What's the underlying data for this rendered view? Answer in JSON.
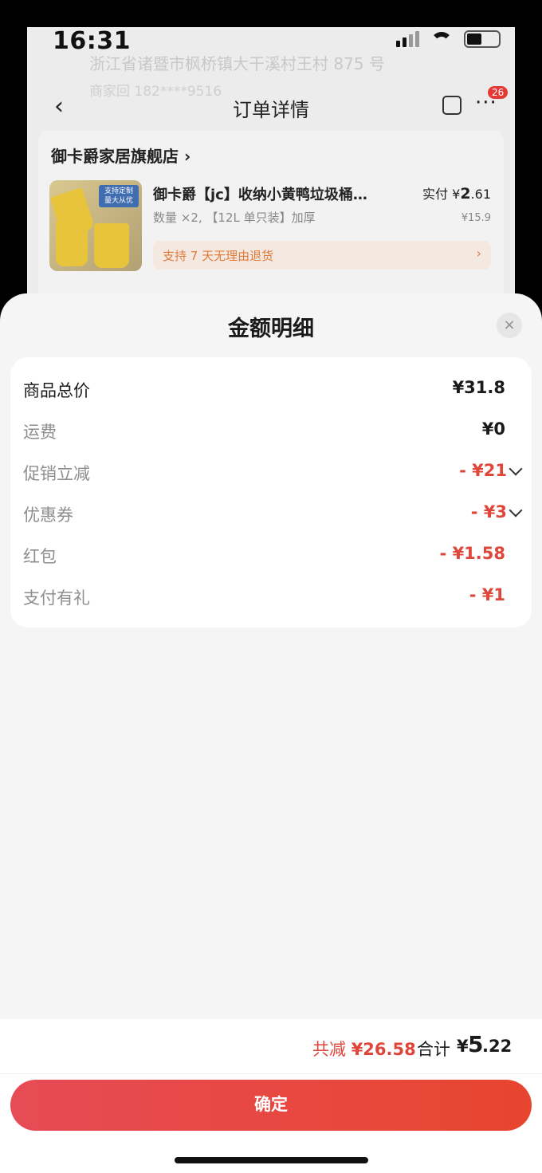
{
  "status_bar": {
    "time": "16:31"
  },
  "background": {
    "address": "浙江省诸暨市枫桥镇大干溪村王村 875 号",
    "phone": "商家回 182****9516",
    "nav_title": "订单详情",
    "badge_count": "26",
    "shop_name": "御卡爵家居旗舰店 ›",
    "product": {
      "title": "御卡爵【jc】收纳小黄鸭垃圾桶…",
      "spec": "数量 ×2, 【12L 单只装】加厚",
      "paid_label": "实付 ¥",
      "paid_int": "2",
      "paid_dec": ".61",
      "orig_price": "¥15.9",
      "image_tag": "支持定制 量大从优"
    },
    "return_text": "支持 7 天无理由退货",
    "return_arrow": "›"
  },
  "sheet": {
    "title": "金额明细",
    "close_glyph": "×",
    "rows": [
      {
        "label": "商品总价",
        "value": "¥31.8"
      },
      {
        "label": "运费",
        "value": "¥0"
      },
      {
        "label": "促销立减",
        "value": "- ¥21"
      },
      {
        "label": "优惠券",
        "value": "- ¥3"
      },
      {
        "label": "红包",
        "value": "- ¥1.58"
      },
      {
        "label": "支付有礼",
        "value": "- ¥1"
      }
    ],
    "footer": {
      "reduce_label": "共减 ",
      "reduce_value": "¥26.58",
      "total_label": "合计",
      "total_symbol": "¥",
      "total_int": "5",
      "total_dec": ".22",
      "confirm_label": "确定"
    }
  },
  "colors": {
    "accent_red": "#e0453a",
    "button_gradient_start": "#e74b55",
    "button_gradient_end": "#e8452f",
    "sheet_bg": "#f5f5f5"
  }
}
